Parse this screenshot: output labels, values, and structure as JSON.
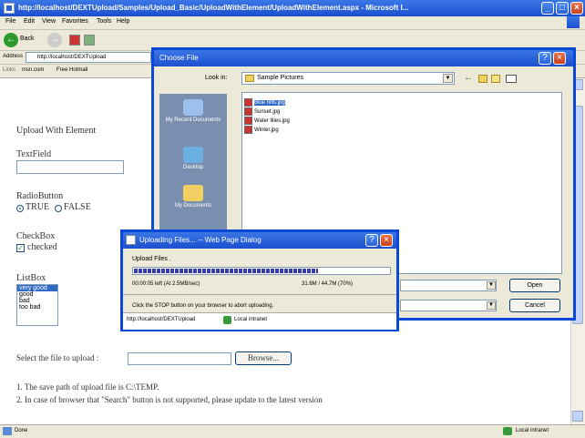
{
  "window": {
    "title": "http://localhost/DEXTUpload/Samples/Upload_Basic/UploadWithElement/UploadWithElement.aspx - Microsoft I...",
    "menu": [
      "File",
      "Edit",
      "View",
      "Favorites",
      "Tools",
      "Help"
    ],
    "back_label": "Back",
    "address_label": "Address",
    "address_value": "http://localhost/DEXTUpload",
    "links": [
      "msn.com",
      "Free Hotmail"
    ],
    "status_left": "Done",
    "status_right": "Local intranet"
  },
  "form": {
    "heading": "Upload With Element",
    "textfield_label": "TextField",
    "textfield_value": "",
    "radio_label": "RadioButton",
    "radio_options": [
      "TRUE",
      "FALSE"
    ],
    "radio_selected": "TRUE",
    "checkbox_label": "CheckBox",
    "checkbox_text": "checked",
    "listbox_label": "ListBox",
    "listbox_items": [
      "very good",
      "good",
      "bad",
      "too bad"
    ],
    "listbox_selected": "very good",
    "file_label": "Select the file to upload :",
    "browse_label": "Browse...",
    "note1": "1. The save path of upload file is C:\\TEMP.",
    "note2": "2. In case of browser that \"Search\" button is not supported, please update to the latest version"
  },
  "choose_file": {
    "title": "Choose File",
    "look_in_label": "Look in:",
    "look_in_value": "Sample Pictures",
    "places": [
      "My Recent Documents",
      "Desktop",
      "My Documents"
    ],
    "files": [
      "Blue hills.jpg",
      "Sunset.jpg",
      "Water lilies.jpg",
      "Winter.jpg"
    ],
    "selected_file": "Blue hills.jpg",
    "open_label": "Open",
    "cancel_label": "Cancel"
  },
  "uploading": {
    "title": "Uploading Files... -- Web Page Dialog",
    "label": "Upload Files .",
    "progress": 0.72,
    "time_text": "00:00:05 left (At 2.5MB/sec)",
    "size_text": "31.6M / 44.7M (70%)",
    "hint": "Click the STOP button on your browser to abort uploading.",
    "url": "http://localhost/DEXTUpload",
    "zone": "Local intranet"
  },
  "colors": {
    "titlebar": "#1c4fcf",
    "accent": "#316ac5",
    "close": "#c9431f"
  }
}
